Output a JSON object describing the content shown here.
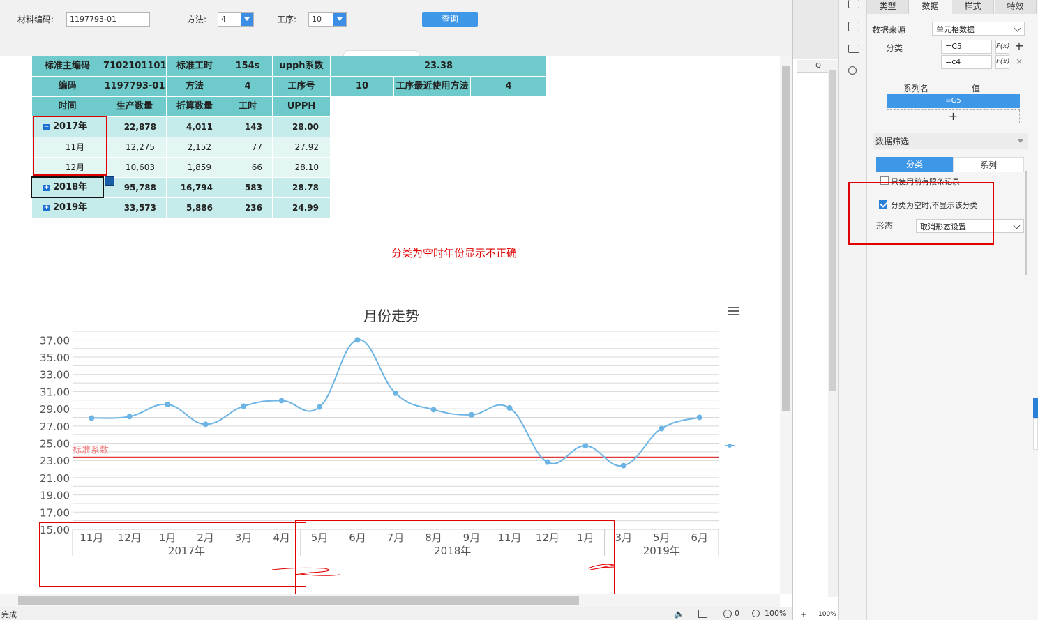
{
  "params": {
    "material_label": "材料编码:",
    "material_value": "1197793-01",
    "method_label": "方法:",
    "method_value": "4",
    "process_label": "工序:",
    "process_value": "10",
    "query_label": "查询"
  },
  "table": {
    "row1": [
      "标准主编码",
      "7102101101",
      "标准工时",
      "154s",
      "upph系数",
      "23.38"
    ],
    "row2": [
      "编码",
      "1197793-01",
      "方法",
      "4",
      "工序号",
      "10",
      "工序最近使用方法",
      "4"
    ],
    "header": [
      "时间",
      "生产数量",
      "折算数量",
      "工时",
      "UPPH"
    ],
    "rows": [
      {
        "time": "2017年",
        "qty": "22,878",
        "conv": "4,011",
        "hours": "143",
        "upph": "28.00",
        "expanded": true
      },
      {
        "time": "11月",
        "qty": "12,275",
        "conv": "2,152",
        "hours": "77",
        "upph": "27.92"
      },
      {
        "time": "12月",
        "qty": "10,603",
        "conv": "1,859",
        "hours": "66",
        "upph": "28.10"
      },
      {
        "time": "2018年",
        "qty": "95,788",
        "conv": "16,794",
        "hours": "583",
        "upph": "28.78",
        "expanded": false
      },
      {
        "time": "2019年",
        "qty": "33,573",
        "conv": "5,886",
        "hours": "236",
        "upph": "24.99",
        "expanded": false
      }
    ],
    "tree_minus": "−",
    "tree_plus": "+"
  },
  "note": "分类为空时年份显示不正确",
  "chart_data": {
    "type": "line",
    "title": "月份走势",
    "categories": [
      "11月",
      "12月",
      "1月",
      "2月",
      "3月",
      "4月",
      "5月",
      "6月",
      "7月",
      "8月",
      "9月",
      "11月",
      "12月",
      "1月",
      "3月",
      "5月",
      "6月"
    ],
    "groups": [
      {
        "label": "2017年",
        "span": [
          0,
          5
        ]
      },
      {
        "label": "2018年",
        "span": [
          6,
          13
        ]
      },
      {
        "label": "2019年",
        "span": [
          14,
          16
        ]
      }
    ],
    "series": [
      {
        "values": [
          27.92,
          28.1,
          29.5,
          27.2,
          29.3,
          29.95,
          29.2,
          37.0,
          30.8,
          28.9,
          28.3,
          29.1,
          22.8,
          24.7,
          22.4,
          26.7,
          28.0
        ]
      }
    ],
    "reference_line": {
      "label": "标准系数",
      "value": 23.38
    },
    "ylim": [
      15,
      38
    ],
    "yticks": [
      "15.00",
      "17.00",
      "19.00",
      "21.00",
      "23.00",
      "25.00",
      "27.00",
      "29.00",
      "31.00",
      "33.00",
      "35.00",
      "37.00"
    ],
    "colors": {
      "line": "#6cb4e4",
      "reference": "#e23a3a",
      "grid": "#d8d8d8"
    },
    "grid": true
  },
  "status": {
    "left": "完成",
    "count": "0",
    "zoom": "100%",
    "zoom2": "100%"
  },
  "sheet": {
    "col": "Q"
  },
  "panel": {
    "tabs": [
      "类型",
      "数据",
      "样式",
      "特效"
    ],
    "active_tab": "数据",
    "source_label": "数据来源",
    "source_value": "单元格数据",
    "category_label": "分类",
    "category_values": [
      "=C5",
      "=c4"
    ],
    "fx_label": "F(x)",
    "series_name_label": "系列名",
    "value_label": "值",
    "series_value": "=G5",
    "add": "+",
    "filter_label": "数据筛选",
    "seg_category": "分类",
    "seg_series": "系列",
    "opt_top_n": "只使用前有限条记录",
    "opt_hide_empty": "分类为空时,不显示该分类",
    "opt_hide_empty_checked": true,
    "form_label": "形态",
    "form_value": "取消形态设置"
  },
  "colors": {
    "header": "#6fcbcb",
    "light": "#c5ecea",
    "accent": "#3f97e8",
    "annotation": "#e00000"
  }
}
